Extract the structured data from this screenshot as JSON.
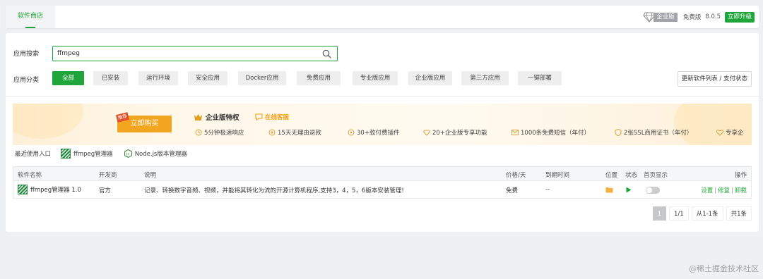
{
  "header": {
    "tab_label": "软件商店",
    "enterprise_label": "企业版",
    "free_label": "免费版",
    "version": "8.0.5",
    "upgrade_label": "立即升级"
  },
  "search": {
    "label": "应用搜索",
    "value": "ffmpeg"
  },
  "categories": {
    "label": "应用分类",
    "items": [
      "全部",
      "已安装",
      "运行环境",
      "安全应用",
      "Docker应用",
      "免费应用",
      "专业版应用",
      "企业版应用",
      "第三方应用",
      "一键部署"
    ],
    "active_index": 0,
    "update_button": "更新软件列表 / 支付状态"
  },
  "banner": {
    "buy_label": "立即购买",
    "badge": "推荐",
    "privilege_title": "企业版特权",
    "online_service": "在线客服",
    "features": [
      "5分钟极速响应",
      "15天无理由退款",
      "30+款付费插件",
      "20+企业版专享功能",
      "1000条免费短信（年付）",
      "2张SSL商用证书（年付）",
      "专享企"
    ]
  },
  "recent": {
    "label": "最近使用入口",
    "items": [
      "ffmpeg管理器",
      "Node.js版本管理器"
    ]
  },
  "table": {
    "headers": {
      "name": "软件名称",
      "developer": "开发商",
      "description": "说明",
      "price": "价格/天",
      "expiry": "到期时间",
      "location": "位置",
      "status": "状态",
      "homepage": "首页显示",
      "actions": "操作"
    },
    "rows": [
      {
        "name": "ffmpeg管理器 1.0",
        "developer": "官方",
        "description": "记录、转换数字音频、视频，并能将其转化为流的开源计算机程序,支持3，4，5，6版本安装管理!",
        "price": "免费",
        "expiry": "--",
        "ops": [
          "设置",
          "修复",
          "卸载"
        ]
      }
    ]
  },
  "pager": {
    "current": "1",
    "pages": "1/1",
    "range": "从1-1条",
    "total": "共1条"
  },
  "watermark": "@稀土掘金技术社区",
  "colors": {
    "accent": "#20a53a",
    "buy": "#f4a51f",
    "badge": "#e2522d"
  }
}
